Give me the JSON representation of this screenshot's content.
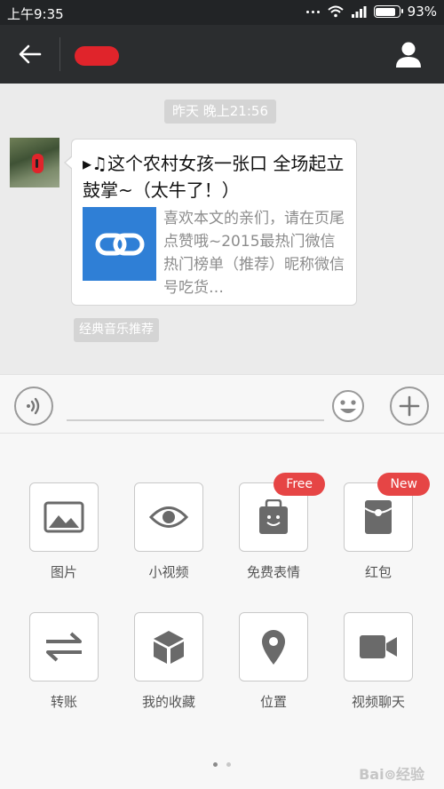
{
  "status_bar": {
    "time": "上午9:35",
    "battery_percent": "93%",
    "battery_level": 0.93,
    "icons": [
      "more-dots-icon",
      "wifi-icon",
      "signal-icon",
      "battery-icon"
    ]
  },
  "title_bar": {
    "contact_name_redacted": true,
    "icons": [
      "back-arrow-icon",
      "profile-icon"
    ]
  },
  "chat": {
    "timestamp": "昨天 晚上21:56",
    "message": {
      "title": "▸♫这个农村女孩一张口 全场起立鼓掌~（太牛了！）",
      "description": "喜欢本文的亲们，请在页尾点赞哦~2015最热门微信热门榜单（推荐）昵称微信号吃货…",
      "thumbnail_icon": "link-icon",
      "thumbnail_color": "#2f7fd6"
    },
    "source_tag": "经典音乐推荐"
  },
  "input_bar": {
    "text_value": "",
    "icons": [
      "voice-icon",
      "emoji-icon",
      "plus-icon"
    ]
  },
  "panel": {
    "items": [
      {
        "label": "图片",
        "icon": "image-icon"
      },
      {
        "label": "小视频",
        "icon": "eye-icon"
      },
      {
        "label": "免费表情",
        "icon": "sticker-icon",
        "badge": "Free"
      },
      {
        "label": "红包",
        "icon": "red-packet-icon",
        "badge": "New"
      },
      {
        "label": "转账",
        "icon": "transfer-icon"
      },
      {
        "label": "我的收藏",
        "icon": "favorites-box-icon"
      },
      {
        "label": "位置",
        "icon": "location-pin-icon"
      },
      {
        "label": "视频聊天",
        "icon": "video-camera-icon"
      }
    ],
    "page_count": 2,
    "current_page": 1
  },
  "colors": {
    "header_bg": "#2b2d2f",
    "chat_bg": "#ebebeb",
    "badge_red": "#e64545",
    "link_blue": "#2f7fd6"
  }
}
